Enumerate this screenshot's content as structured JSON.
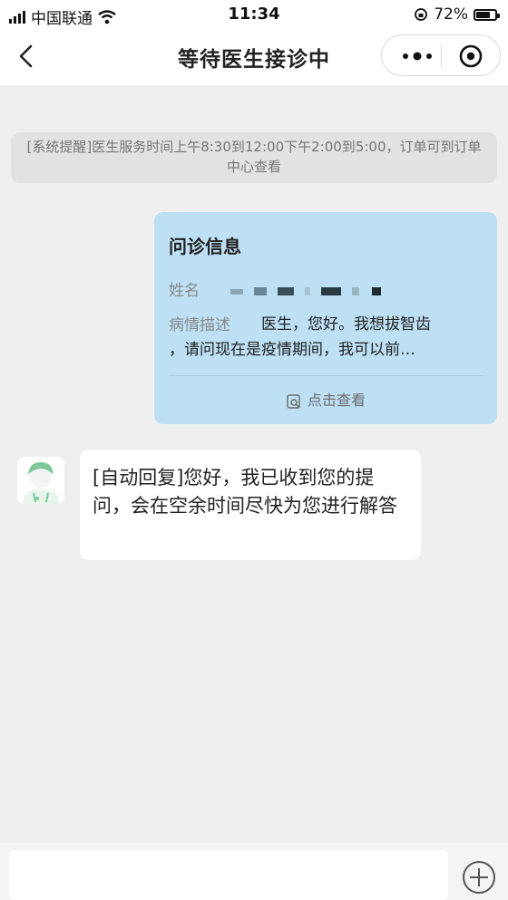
{
  "status_bar": {
    "carrier": "中国联通",
    "time": "11:34",
    "battery": "72%"
  },
  "nav": {
    "title": "等待医生接诊中"
  },
  "system_notice": "[系统提醒]医生服务时间上午8:30到12:00下午2:00到5:00，订单可到订单中心查看",
  "consult_card": {
    "title": "问诊信息",
    "name_label": "姓名",
    "desc_label": "病情描述",
    "desc_line1": "医生，您好。我想拔智齿",
    "desc_line2": "，请问现在是疫情期间，我可以前…",
    "view_label": "点击查看"
  },
  "auto_reply": "[自动回复]您好，我已收到您的提问，会在空余时间尽快为您进行解答",
  "input": {
    "placeholder": ""
  },
  "colors": {
    "card_bg": "#bde0f4",
    "page_bg": "#efefef",
    "avatar_green": "#7dc99a"
  },
  "icons": [
    "back-arrow-icon",
    "more-icon",
    "target-close-icon",
    "view-doc-icon",
    "plus-icon",
    "wifi-icon",
    "signal-icon",
    "battery-icon"
  ]
}
